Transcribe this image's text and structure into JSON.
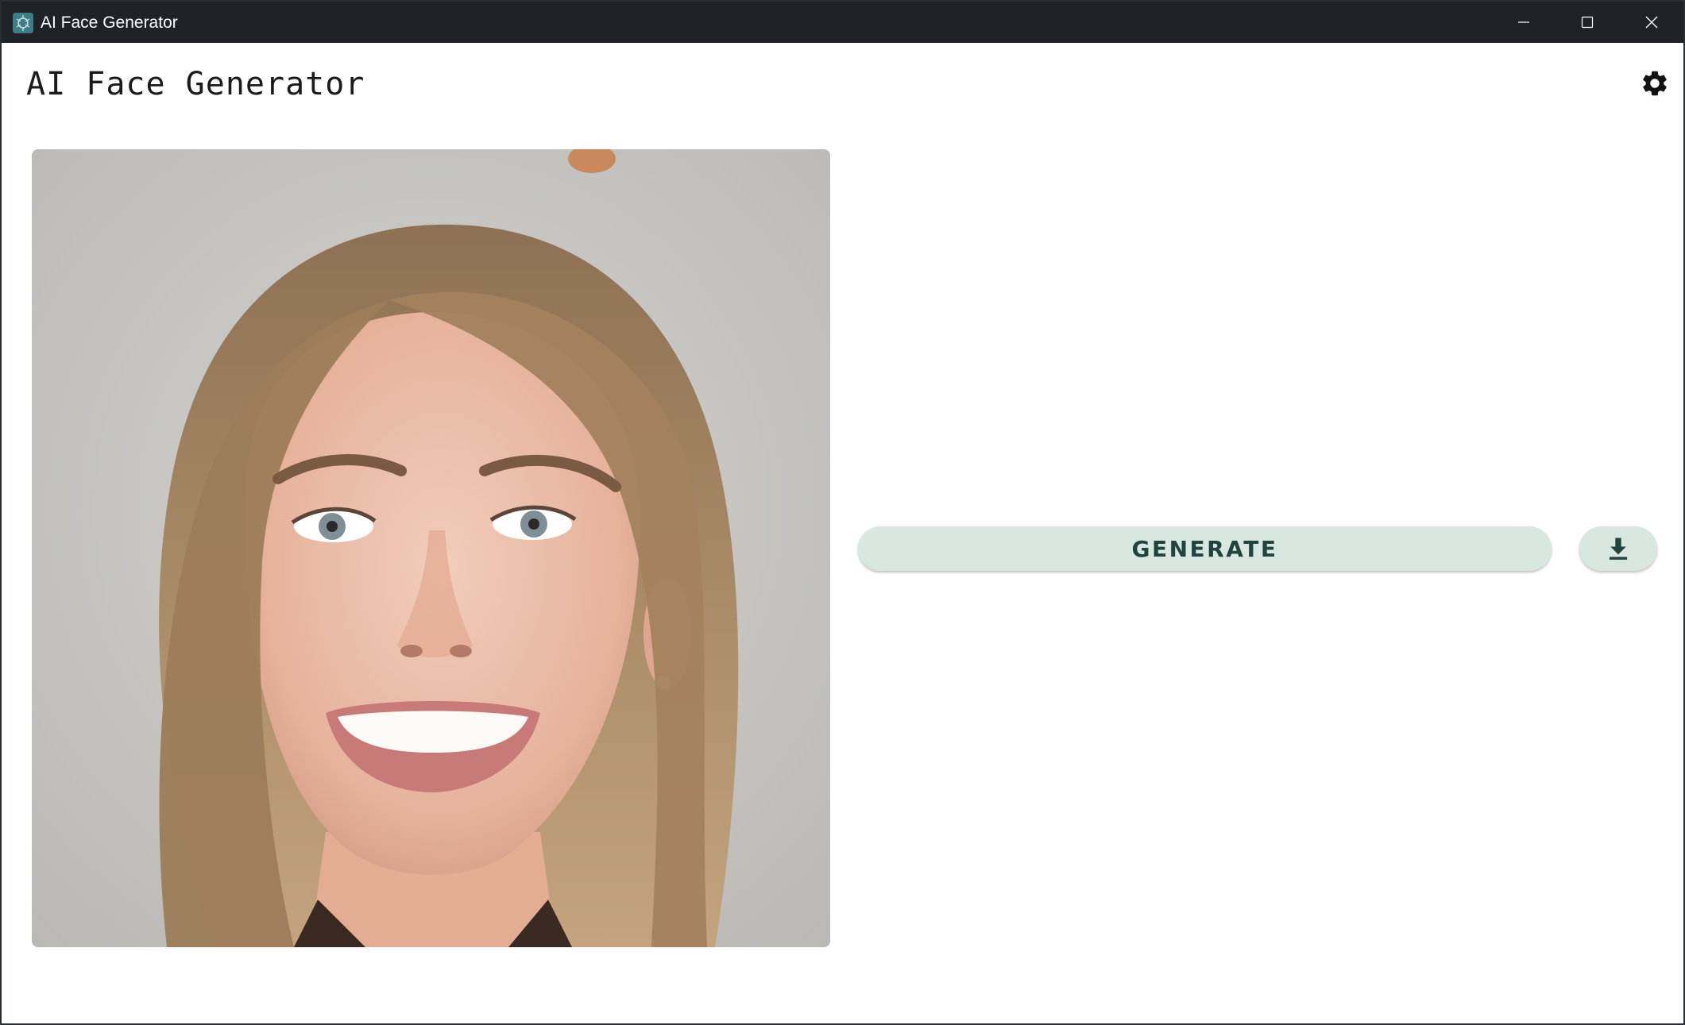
{
  "window": {
    "title": "AI Face Generator",
    "icon": "app-logo-icon",
    "controls": [
      "minimize-icon",
      "maximize-icon",
      "close-icon"
    ]
  },
  "header": {
    "title": "AI Face Generator",
    "settings_icon": "gear-icon"
  },
  "main": {
    "image_alt": "Generated face",
    "generate_label": "GENERATE",
    "download_icon": "download-icon"
  },
  "colors": {
    "titlebar": "#1f2328",
    "button_bg": "#d8e8e0",
    "button_text": "#23433f",
    "background": "#ffffff"
  }
}
